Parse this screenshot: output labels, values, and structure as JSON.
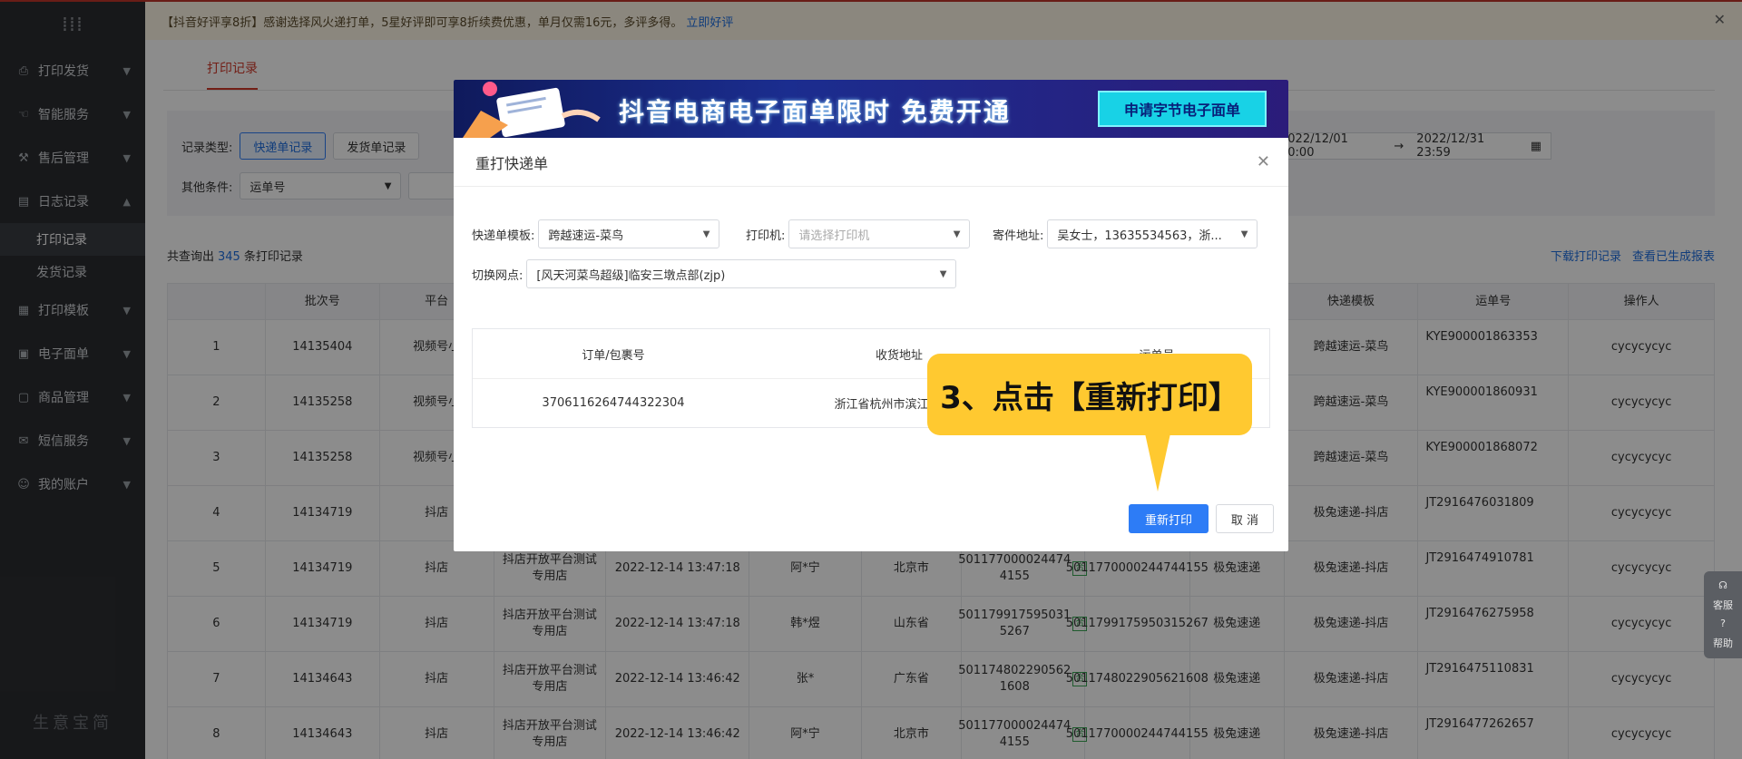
{
  "sidebar": {
    "logo": "⁞⁞⁞",
    "groups": [
      {
        "label": "打印发货",
        "icon": "printer-icon"
      },
      {
        "label": "智能服务",
        "icon": "hand-icon"
      },
      {
        "label": "售后管理",
        "icon": "wrench-icon"
      },
      {
        "label": "日志记录",
        "icon": "log-icon"
      }
    ],
    "subitems": [
      {
        "label": "打印记录"
      },
      {
        "label": "发货记录"
      }
    ],
    "groups2": [
      {
        "label": "打印模板"
      },
      {
        "label": "电子面单"
      },
      {
        "label": "商品管理"
      },
      {
        "label": "短信服务"
      },
      {
        "label": "我的账户"
      }
    ],
    "footer": "生意宝简"
  },
  "notice": {
    "text": "【抖音好评享8折】感谢选择风火递打单，5星好评即可享8折续费优惠，单月仅需16元，多评多得。",
    "link": "立即好评"
  },
  "tabs": {
    "active": "打印记录"
  },
  "filter": {
    "record_type_label": "记录类型:",
    "record_types": [
      "快递单记录",
      "发货单记录"
    ],
    "other_label": "其他条件:",
    "other_select": "运单号",
    "date_start": "2022/12/01 00:00",
    "date_end": "2022/12/31 23:59"
  },
  "summary": {
    "prefix": "共查询出",
    "count": "345",
    "suffix": "条打印记录"
  },
  "links": {
    "download": "下载打印记录",
    "view_report": "查看已生成报表"
  },
  "table": {
    "headers": [
      "",
      "批次号",
      "平台",
      "",
      "",
      "",
      "",
      "",
      "",
      "",
      "快递模板",
      "运单号",
      "操作人"
    ],
    "rows": [
      {
        "idx": "1",
        "batch": "14135404",
        "platform": "视频号小",
        "shop": "",
        "time": "",
        "recv": "",
        "prov": "",
        "pkg": "",
        "waybill2": "",
        "company": "",
        "tpl": "跨越速运-菜鸟",
        "waybill": "KYE900001863353",
        "op": "cycycycyc"
      },
      {
        "idx": "2",
        "batch": "14135258",
        "platform": "视频号小",
        "shop": "",
        "time": "",
        "recv": "",
        "prov": "",
        "pkg": "",
        "waybill2": "",
        "company": "",
        "tpl": "跨越速运-菜鸟",
        "waybill": "KYE900001860931",
        "op": "cycycycyc"
      },
      {
        "idx": "3",
        "batch": "14135258",
        "platform": "视频号小",
        "shop": "",
        "time": "",
        "recv": "",
        "prov": "",
        "pkg": "",
        "waybill2": "",
        "company": "",
        "tpl": "跨越速运-菜鸟",
        "waybill": "KYE900001868072",
        "op": "cycycycyc"
      },
      {
        "idx": "4",
        "batch": "14134719",
        "platform": "抖店",
        "shop": "",
        "time": "",
        "recv": "",
        "prov": "",
        "pkg": "",
        "waybill2": "",
        "company": "",
        "tpl": "极兔速递-抖店",
        "waybill": "JT2916476031809",
        "op": "cycycycyc"
      },
      {
        "idx": "5",
        "batch": "14134719",
        "platform": "抖店",
        "shop": "抖店开放平台测试专用店",
        "time": "2022-12-14 13:47:18",
        "recv": "阿*宁",
        "prov": "北京市",
        "pkg": "501177000024474 4155",
        "waybill2": "5011770000244744155",
        "company": "极兔速递",
        "tpl": "极兔速递-抖店",
        "waybill": "JT2916474910781",
        "op": "cycycycyc"
      },
      {
        "idx": "6",
        "batch": "14134719",
        "platform": "抖店",
        "shop": "抖店开放平台测试专用店",
        "time": "2022-12-14 13:47:18",
        "recv": "韩*煜",
        "prov": "山东省",
        "pkg": "501179917595031 5267",
        "waybill2": "5011799175950315267",
        "company": "极兔速递",
        "tpl": "极兔速递-抖店",
        "waybill": "JT2916476275958",
        "op": "cycycycyc"
      },
      {
        "idx": "7",
        "batch": "14134643",
        "platform": "抖店",
        "shop": "抖店开放平台测试专用店",
        "time": "2022-12-14 13:46:42",
        "recv": "张*",
        "prov": "广东省",
        "pkg": "501174802290562 1608",
        "waybill2": "5011748022905621608",
        "company": "极兔速递",
        "tpl": "极兔速递-抖店",
        "waybill": "JT2916475110831",
        "op": "cycycycyc"
      },
      {
        "idx": "8",
        "batch": "14134643",
        "platform": "抖店",
        "shop": "抖店开放平台测试专用店",
        "time": "2022-12-14 13:46:42",
        "recv": "阿*宁",
        "prov": "北京市",
        "pkg": "501177000024474 4155",
        "waybill2": "5011770000244744155",
        "company": "极兔速递",
        "tpl": "极兔速递-抖店",
        "waybill": "JT2916477262657",
        "op": "cycycycyc"
      }
    ],
    "tag_he": "合"
  },
  "dialog": {
    "banner_title": "抖音电商电子面单限时 免费开通",
    "banner_cta": "申请字节电子面单",
    "title": "重打快递单",
    "template_label": "快递单模板:",
    "template_value": "跨越速运-菜鸟",
    "printer_label": "打印机:",
    "printer_placeholder": "请选择打印机",
    "sender_label": "寄件地址:",
    "sender_value": "吴女士，13635534563，浙...",
    "branch_label": "切换网点:",
    "branch_value": "[风天河菜鸟超级]临安三墩点部(zjp)",
    "inner_headers": [
      "订单/包裹号",
      "收货地址",
      "运单号"
    ],
    "inner_row": [
      "3706116264744322304",
      "浙江省杭州市滨江区西兴",
      ""
    ],
    "reprint_button": "重新打印",
    "cancel_button": "取 消"
  },
  "callout": {
    "text": "3、点击【重新打印】"
  },
  "help": {
    "service": "客服",
    "help": "帮助"
  },
  "colors": {
    "accent": "#2d7cf6",
    "brand_red": "#d0392b",
    "callout": "#ffc930"
  }
}
